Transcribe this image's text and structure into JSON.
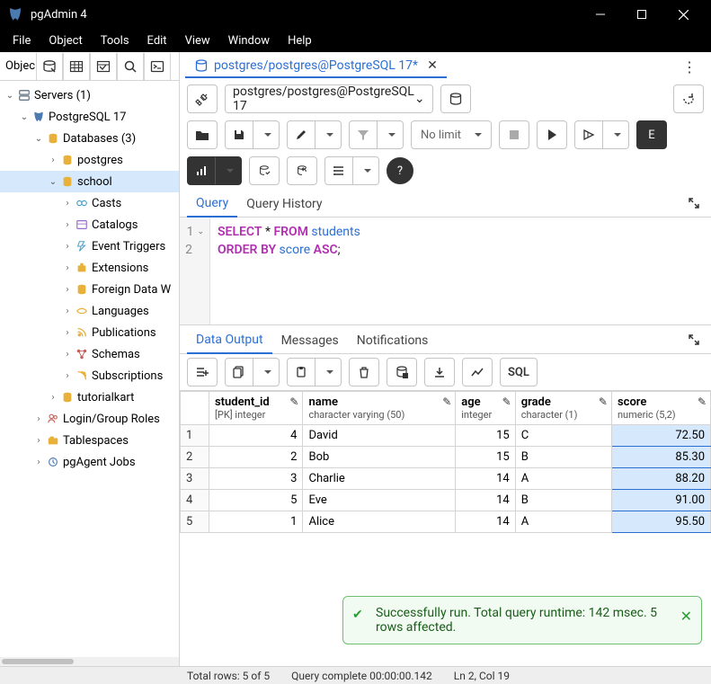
{
  "window": {
    "title": "pgAdmin 4"
  },
  "menus": [
    "File",
    "Object",
    "Tools",
    "Edit",
    "View",
    "Window",
    "Help"
  ],
  "sidebar": {
    "header": "Objec",
    "tree": {
      "servers": "Servers (1)",
      "pg": "PostgreSQL 17",
      "databases": "Databases (3)",
      "postgres": "postgres",
      "school": "school",
      "casts": "Casts",
      "catalogs": "Catalogs",
      "event_triggers": "Event Triggers",
      "extensions": "Extensions",
      "fdw": "Foreign Data W",
      "languages": "Languages",
      "publications": "Publications",
      "schemas": "Schemas",
      "subscriptions": "Subscriptions",
      "tutorialkart": "tutorialkart",
      "login_roles": "Login/Group Roles",
      "tablespaces": "Tablespaces",
      "pgagent": "pgAgent Jobs"
    }
  },
  "tab": {
    "title": "postgres/postgres@PostgreSQL 17*",
    "conn": "postgres/postgres@PostgreSQL 17"
  },
  "toolbar": {
    "nolimit": "No limit",
    "sql": "SQL"
  },
  "query_tabs": {
    "query": "Query",
    "history": "Query History"
  },
  "sql": {
    "line1_select": "SELECT",
    "line1_star": " * ",
    "line1_from": "FROM",
    "line1_ident": " students",
    "line2_order": "ORDER",
    "line2_by": " BY",
    "line2_ident": " score ",
    "line2_asc": "ASC",
    "line2_semi": ";"
  },
  "out_tabs": {
    "data": "Data Output",
    "messages": "Messages",
    "notifications": "Notifications"
  },
  "columns": [
    {
      "name": "student_id",
      "type": "[PK] integer"
    },
    {
      "name": "name",
      "type": "character varying (50)"
    },
    {
      "name": "age",
      "type": "integer"
    },
    {
      "name": "grade",
      "type": "character (1)"
    },
    {
      "name": "score",
      "type": "numeric (5,2)"
    }
  ],
  "rows": [
    {
      "n": "1",
      "student_id": "4",
      "name": "David",
      "age": "15",
      "grade": "C",
      "score": "72.50"
    },
    {
      "n": "2",
      "student_id": "2",
      "name": "Bob",
      "age": "15",
      "grade": "B",
      "score": "85.30"
    },
    {
      "n": "3",
      "student_id": "3",
      "name": "Charlie",
      "age": "14",
      "grade": "A",
      "score": "88.20"
    },
    {
      "n": "4",
      "student_id": "5",
      "name": "Eve",
      "age": "14",
      "grade": "B",
      "score": "91.00"
    },
    {
      "n": "5",
      "student_id": "1",
      "name": "Alice",
      "age": "14",
      "grade": "A",
      "score": "95.50"
    }
  ],
  "toast": "Successfully run. Total query runtime: 142 msec. 5 rows affected.",
  "status": {
    "rows": "Total rows: 5 of 5",
    "complete": "Query complete 00:00:00.142",
    "pos": "Ln 2, Col 19"
  }
}
